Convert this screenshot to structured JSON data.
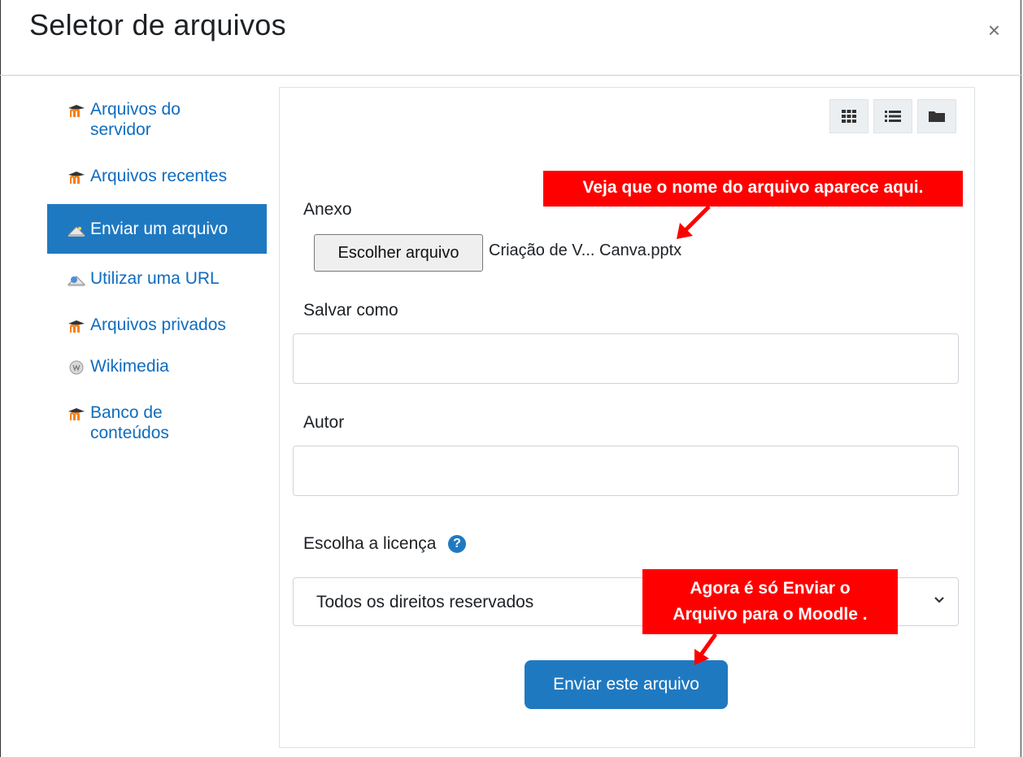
{
  "dialog": {
    "title": "Seletor de arquivos",
    "close_symbol": "×"
  },
  "sidebar": {
    "items": [
      {
        "label": "Arquivos do servidor",
        "icon": "moodle-icon",
        "active": false
      },
      {
        "label": "Arquivos recentes",
        "icon": "moodle-icon",
        "active": false
      },
      {
        "label": "Enviar um arquivo",
        "icon": "upload-icon",
        "active": true
      },
      {
        "label": "Utilizar uma URL",
        "icon": "url-icon",
        "active": false
      },
      {
        "label": "Arquivos privados",
        "icon": "moodle-icon",
        "active": false
      },
      {
        "label": "Wikimedia",
        "icon": "wikimedia-icon",
        "active": false
      },
      {
        "label": "Banco de conteúdos",
        "icon": "moodle-icon",
        "active": false
      }
    ]
  },
  "toolbar": {
    "view_icons": [
      "grid-view-icon",
      "list-view-icon",
      "folder-view-icon"
    ]
  },
  "form": {
    "attachment_label": "Anexo",
    "choose_file_label": "Escolher arquivo",
    "file_name": "Criação de V... Canva.pptx",
    "save_as_label": "Salvar como",
    "save_as_value": "",
    "author_label": "Autor",
    "author_value": "",
    "license_label": "Escolha a licença",
    "license_value": "Todos os direitos reservados",
    "submit_label": "Enviar este arquivo"
  },
  "annotations": {
    "callout_file": "Veja que o nome do arquivo aparece aqui.",
    "callout_submit_line1": "Agora é só Enviar o",
    "callout_submit_line2": "Arquivo para o Moodle ."
  },
  "colors": {
    "accent": "#1f79c1",
    "link": "#0f6cbf",
    "callout": "#ff0000"
  }
}
